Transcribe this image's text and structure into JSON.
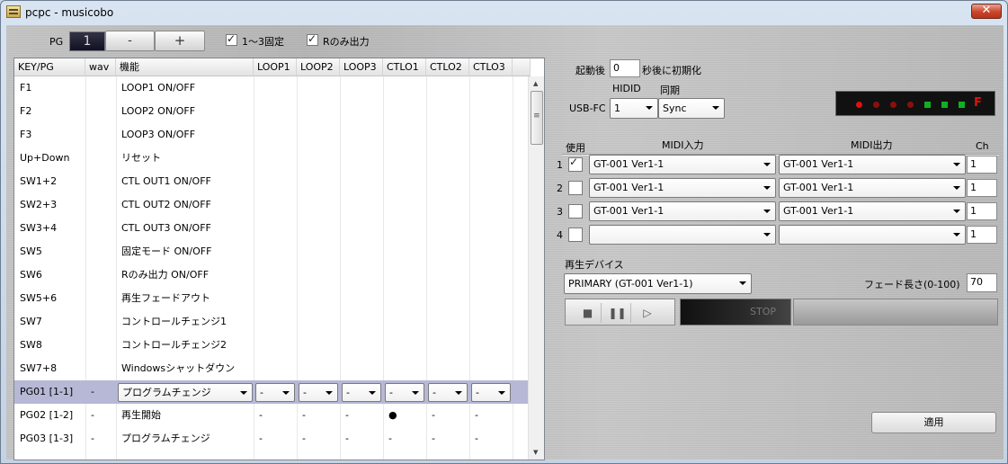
{
  "window": {
    "title": "pcpc - musicobo",
    "close": "✕"
  },
  "toolbar": {
    "pg_label": "PG",
    "pg_value": "1",
    "minus": "-",
    "plus": "+",
    "fixed13_label": "1～3固定",
    "fixed13_checked": true,
    "ronly_label": "Rのみ出力",
    "ronly_checked": true
  },
  "grid": {
    "headers": [
      "KEY/PG",
      "wav",
      "機能",
      "LOOP1",
      "LOOP2",
      "LOOP3",
      "CTLO1",
      "CTLO2",
      "CTLO3"
    ],
    "rows": [
      {
        "key": "F1",
        "wav": "",
        "func": "LOOP1 ON/OFF"
      },
      {
        "key": "F2",
        "wav": "",
        "func": "LOOP2 ON/OFF"
      },
      {
        "key": "F3",
        "wav": "",
        "func": "LOOP3 ON/OFF"
      },
      {
        "key": "Up+Down",
        "wav": "",
        "func": "リセット"
      },
      {
        "key": "SW1+2",
        "wav": "",
        "func": "CTL OUT1 ON/OFF"
      },
      {
        "key": "SW2+3",
        "wav": "",
        "func": "CTL OUT2 ON/OFF"
      },
      {
        "key": "SW3+4",
        "wav": "",
        "func": "CTL OUT3 ON/OFF"
      },
      {
        "key": "SW5",
        "wav": "",
        "func": "固定モード ON/OFF"
      },
      {
        "key": "SW6",
        "wav": "",
        "func": "Rのみ出力 ON/OFF"
      },
      {
        "key": "SW5+6",
        "wav": "",
        "func": "再生フェードアウト"
      },
      {
        "key": "SW7",
        "wav": "",
        "func": "コントロールチェンジ1"
      },
      {
        "key": "SW8",
        "wav": "",
        "func": "コントロールチェンジ2"
      },
      {
        "key": "SW7+8",
        "wav": "",
        "func": "Windowsシャットダウン"
      }
    ],
    "selected_row": {
      "key": "PG01  [1-1]",
      "wav": "-",
      "func": "プログラムチェンジ",
      "vals": [
        "-",
        "-",
        "-",
        "-",
        "-",
        "-"
      ]
    },
    "row_pg02": {
      "key": "PG02  [1-2]",
      "wav": "-",
      "func": "再生開始",
      "vals": [
        "-",
        "-",
        "-",
        "●",
        "-",
        "-"
      ]
    },
    "row_pg03": {
      "key": "PG03  [1-3]",
      "wav": "-",
      "func": "プログラムチェンジ",
      "vals": [
        "-",
        "-",
        "-",
        "-",
        "-",
        "-"
      ]
    }
  },
  "settings": {
    "startup_before": "起動後",
    "startup_value": "0",
    "startup_after": "秒後に初期化",
    "hidid_label": "HIDID",
    "sync_label": "同期",
    "usbfc_label": "USB-FC",
    "hidid_value": "1",
    "sync_value": "Sync",
    "led_letter": "F",
    "use_label": "使用",
    "midi_in_label": "MIDI入力",
    "midi_out_label": "MIDI出力",
    "ch_label": "Ch",
    "midi_rows": [
      {
        "num": "1",
        "checked": true,
        "in": "GT-001 Ver1-1",
        "out": "GT-001 Ver1-1",
        "ch": "1"
      },
      {
        "num": "2",
        "checked": false,
        "in": "GT-001 Ver1-1",
        "out": "GT-001 Ver1-1",
        "ch": "1"
      },
      {
        "num": "3",
        "checked": false,
        "in": "GT-001 Ver1-1",
        "out": "GT-001 Ver1-1",
        "ch": "1"
      },
      {
        "num": "4",
        "checked": false,
        "in": "",
        "out": "",
        "ch": "1"
      }
    ],
    "playback_label": "再生デバイス",
    "playback_value": "PRIMARY (GT-001 Ver1-1)",
    "fade_label": "フェード長さ(0-100)",
    "fade_value": "70",
    "status": "STOP",
    "apply": "適用"
  },
  "colors": {
    "led_red": "#e01010",
    "led_green": "#10b020",
    "selected_row": "#b7b8d6"
  }
}
